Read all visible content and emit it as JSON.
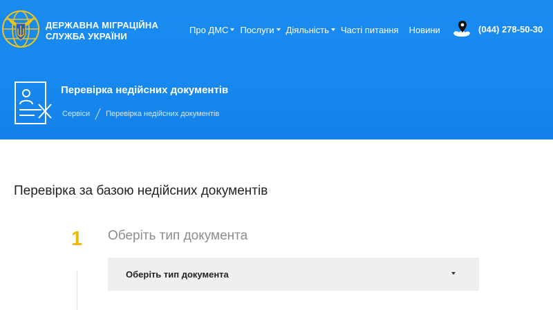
{
  "header": {
    "org_name_line1": "ДЕРЖАВНА МІГРАЦІЙНА",
    "org_name_line2": "СЛУЖБА УКРАЇНИ",
    "nav": [
      {
        "label": "Про ДМС",
        "has_dropdown": true
      },
      {
        "label": "Послуги",
        "has_dropdown": true
      },
      {
        "label": "Діяльність",
        "has_dropdown": true
      },
      {
        "label": "Часті питання",
        "has_dropdown": false
      },
      {
        "label": "Новини",
        "has_dropdown": false
      }
    ],
    "phone": "(044) 278-50-30",
    "icons": {
      "logo": "coat-of-arms-logo",
      "location": "location-pin-icon"
    }
  },
  "banner": {
    "title": "Перевірка недійсних документів",
    "breadcrumb": [
      "Сервіси",
      "Перевірка недійсних документів"
    ],
    "icon": "document-cross-icon"
  },
  "main": {
    "heading": "Перевірка за базою недійсних документів",
    "step": {
      "number": "1",
      "title": "Оберіть тип документа",
      "select_value": "Оберіть тип документа"
    }
  },
  "colors": {
    "header_blue": "#1788ee",
    "step_number": "#f5b800",
    "select_bg": "#efefef"
  }
}
